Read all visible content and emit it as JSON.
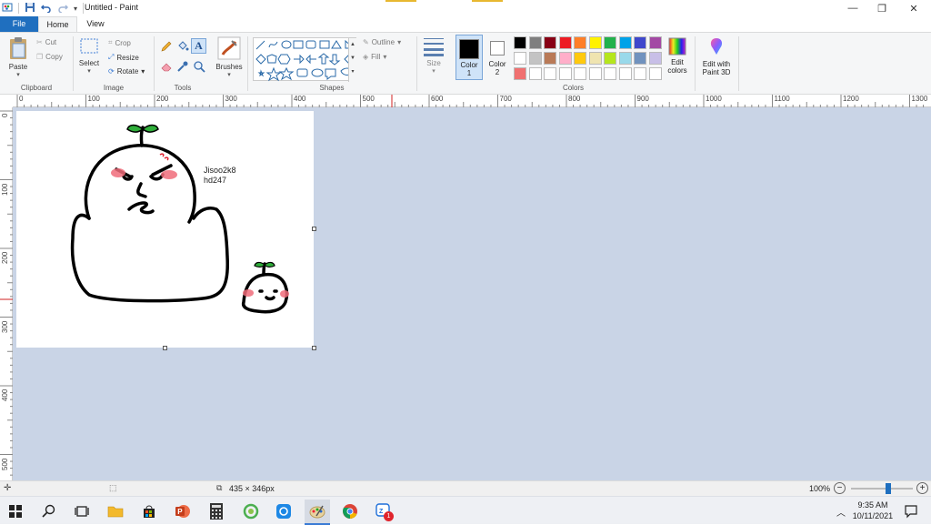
{
  "window": {
    "title": "Untitled - Paint",
    "minimize": "—",
    "restore": "❐",
    "close": "✕"
  },
  "tabs": {
    "file": "File",
    "home": "Home",
    "view": "View"
  },
  "ribbon": {
    "clipboard": {
      "group_label": "Clipboard",
      "paste": "Paste",
      "cut": "Cut",
      "copy": "Copy"
    },
    "image": {
      "group_label": "Image",
      "select": "Select",
      "crop": "Crop",
      "resize": "Resize",
      "rotate": "Rotate"
    },
    "tools": {
      "group_label": "Tools"
    },
    "brushes": {
      "label": "Brushes"
    },
    "shapes": {
      "group_label": "Shapes",
      "outline": "Outline",
      "fill": "Fill"
    },
    "size": {
      "label": "Size"
    },
    "colors": {
      "group_label": "Colors",
      "color1_label": "Color",
      "color1_num": "1",
      "color2_label": "Color",
      "color2_num": "2",
      "color1": "#000000",
      "color2": "#ffffff",
      "edit_colors_line1": "Edit",
      "edit_colors_line2": "colors",
      "paint3d_line1": "Edit with",
      "paint3d_line2": "Paint 3D",
      "palette_row1": [
        "#000000",
        "#7f7f7f",
        "#880015",
        "#ed1c24",
        "#ff7f27",
        "#fff200",
        "#22b14c",
        "#00a2e8",
        "#3f48cc",
        "#a349a4"
      ],
      "palette_row2": [
        "#ffffff",
        "#c3c3c3",
        "#b97a57",
        "#ffaec9",
        "#ffc90e",
        "#efe4b0",
        "#b5e61d",
        "#99d9ea",
        "#7092be",
        "#c8bfe7"
      ],
      "palette_row3": [
        "#f07070",
        "#ffffff",
        "#ffffff",
        "#ffffff",
        "#ffffff",
        "#ffffff",
        "#ffffff",
        "#ffffff",
        "#ffffff",
        "#ffffff"
      ]
    }
  },
  "ruler": {
    "top_ticks": [
      "0",
      "100",
      "200",
      "300",
      "400",
      "500",
      "600",
      "700",
      "800",
      "900",
      "1000",
      "1100",
      "1200",
      "1300"
    ],
    "left_ticks": [
      "0",
      "100",
      "200",
      "300",
      "400",
      "500"
    ]
  },
  "canvas": {
    "text_line1": "Jisoo2k8",
    "text_line2": "hd247"
  },
  "status": {
    "dimensions": "435 × 346px",
    "zoom": "100%",
    "zoom_level_fraction": 0.6
  },
  "taskbar": {
    "time": "9:35 AM",
    "date": "10/11/2021",
    "badge": "1"
  }
}
